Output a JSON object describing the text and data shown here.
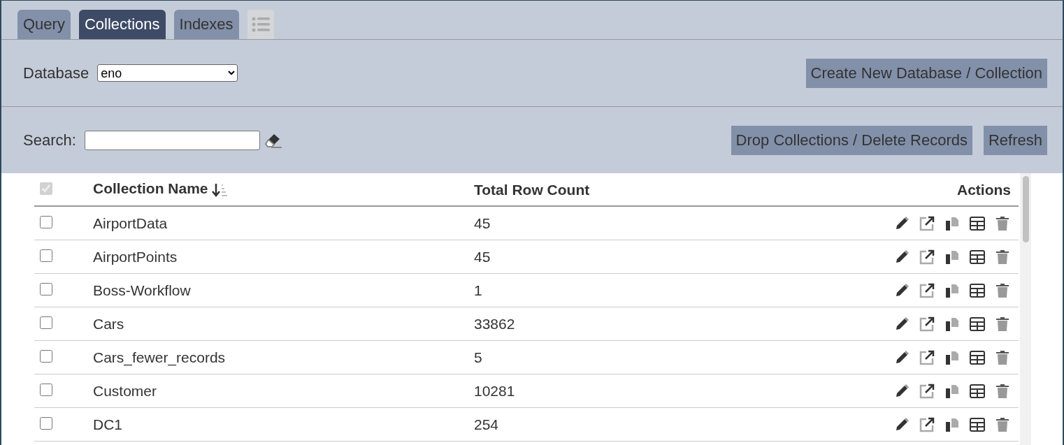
{
  "tabs": [
    {
      "label": "Query",
      "selected": false
    },
    {
      "label": "Collections",
      "selected": true
    },
    {
      "label": "Indexes",
      "selected": false
    }
  ],
  "database": {
    "label": "Database",
    "value": "eno"
  },
  "create_button": "Create New Database / Collection",
  "search": {
    "label": "Search:"
  },
  "buttons": [
    "Drop Collections / Delete Records",
    "Refresh"
  ],
  "table": {
    "select_all_checked": true,
    "columns": [
      "Collection Name",
      "Total Row Count",
      "Actions"
    ],
    "rows": [
      {
        "name": "AirportData",
        "count": "45",
        "checked": false
      },
      {
        "name": "AirportPoints",
        "count": "45",
        "checked": false
      },
      {
        "name": "Boss-Workflow",
        "count": "1",
        "checked": false
      },
      {
        "name": "Cars",
        "count": "33862",
        "checked": false
      },
      {
        "name": "Cars_fewer_records",
        "count": "5",
        "checked": false
      },
      {
        "name": "Customer",
        "count": "10281",
        "checked": false
      },
      {
        "name": "DC1",
        "count": "254",
        "checked": false
      }
    ]
  }
}
